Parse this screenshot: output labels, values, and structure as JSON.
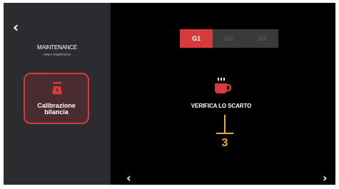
{
  "sidebar": {
    "title": "MAINTENANCE",
    "subtitle": "AREA RISERVATA",
    "calibration_label_line1": "Calibrazione",
    "calibration_label_line2": "bilancia"
  },
  "tabs": [
    {
      "label": "G1",
      "active": true
    },
    {
      "label": "G2",
      "active": false
    },
    {
      "label": "G3",
      "active": false
    }
  ],
  "main": {
    "instruction": "VERIFICA LO SCARTO"
  },
  "annotation": {
    "number": "3"
  },
  "colors": {
    "accent": "#d83a3c",
    "sidebar_bg": "#2a2c30",
    "annotation": "#f0a830"
  },
  "icons": {
    "back": "chevron-left-icon",
    "calibration": "scale-icon",
    "cup": "coffee-cup-icon",
    "prev": "chevron-left-icon",
    "next": "chevron-right-icon"
  }
}
